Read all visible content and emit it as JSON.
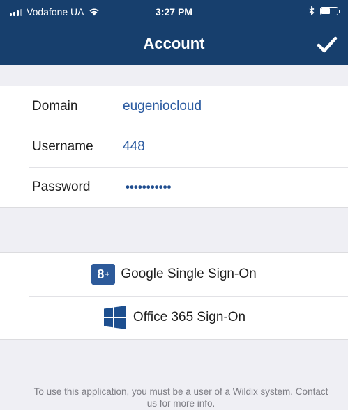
{
  "status_bar": {
    "carrier": "Vodafone UA",
    "time": "3:27 PM"
  },
  "nav": {
    "title": "Account",
    "done_icon": "checkmark-icon"
  },
  "account_form": {
    "fields": [
      {
        "label": "Domain",
        "value": "eugeniocloud"
      },
      {
        "label": "Username",
        "value": "448"
      },
      {
        "label": "Password",
        "value": "•••••••••••"
      }
    ]
  },
  "sso": {
    "google": {
      "label": "Google Single Sign-On",
      "icon": "google-plus-icon",
      "icon_text": "8"
    },
    "office": {
      "label": "Office 365 Sign-On",
      "icon": "windows-icon"
    }
  },
  "footer": {
    "note": "To use this application, you must be a user of a Wildix system. Contact us for more info."
  },
  "colors": {
    "nav_background": "#173f6d",
    "value_text": "#2a5aa0",
    "page_background": "#efeff4",
    "google_icon": "#2d5a9a",
    "windows_icon": "#1d4f8f"
  }
}
